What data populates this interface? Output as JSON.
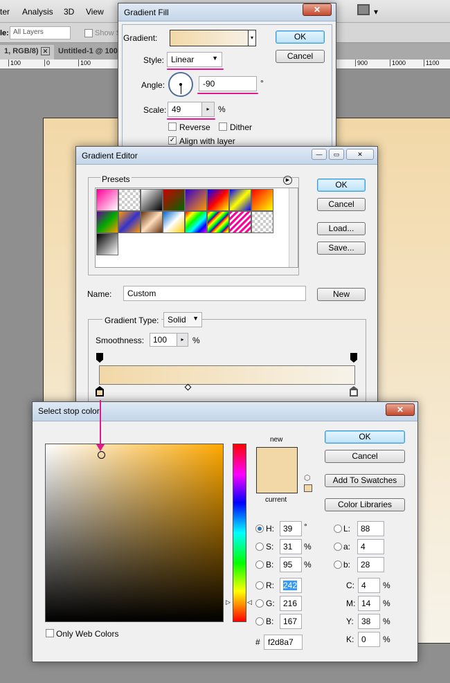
{
  "app": {
    "menu": [
      "ter",
      "Analysis",
      "3D",
      "View"
    ],
    "options": {
      "layers_label": "le:",
      "layers_value": "All Layers",
      "show_label": "Show S"
    },
    "tabs": [
      "1, RGB/8)",
      "Untitled-1 @ 100"
    ],
    "ruler": [
      "100",
      "0",
      "100",
      "900",
      "1000",
      "1100"
    ]
  },
  "gradient_fill": {
    "title": "Gradient Fill",
    "gradient_label": "Gradient:",
    "style_label": "Style:",
    "style_value": "Linear",
    "angle_label": "Angle:",
    "angle_value": "-90",
    "angle_unit": "°",
    "scale_label": "Scale:",
    "scale_value": "49",
    "scale_unit": "%",
    "reverse": "Reverse",
    "dither": "Dither",
    "align": "Align with layer",
    "align_checked": true,
    "ok": "OK",
    "cancel": "Cancel"
  },
  "gradient_editor": {
    "title": "Gradient Editor",
    "presets_label": "Presets",
    "ok": "OK",
    "cancel": "Cancel",
    "load": "Load...",
    "save": "Save...",
    "name_label": "Name:",
    "name_value": "Custom",
    "new": "New",
    "type_label": "Gradient Type:",
    "type_value": "Solid",
    "smooth_label": "Smoothness:",
    "smooth_value": "100",
    "smooth_unit": "%",
    "gradient_colors": [
      "#f2d8a7",
      "#f7f3ea"
    ]
  },
  "stop_color": {
    "title": "Select stop color:",
    "new_label": "new",
    "current_label": "current",
    "ok": "OK",
    "cancel": "Cancel",
    "add_swatches": "Add To Swatches",
    "libraries": "Color Libraries",
    "only_web": "Only Web Colors",
    "color": "#f2d8a7",
    "hue_base": "#ffa800",
    "fields": {
      "H": "39",
      "S": "31",
      "B": "95",
      "R": "242",
      "G": "216",
      "Bl": "167",
      "L": "88",
      "a": "4",
      "b": "28",
      "C": "4",
      "M": "14",
      "Y": "38",
      "K": "0",
      "hex": "f2d8a7"
    },
    "labels": {
      "H": "H:",
      "S": "S:",
      "B": "B:",
      "R": "R:",
      "G": "G:",
      "Bl": "B:",
      "L": "L:",
      "a": "a:",
      "b": "b:",
      "C": "C:",
      "M": "M:",
      "Y": "Y:",
      "K": "K:",
      "hash": "#",
      "deg": "°",
      "pct": "%"
    },
    "selected_mode": "H"
  },
  "annotation_color": "#e0198c"
}
